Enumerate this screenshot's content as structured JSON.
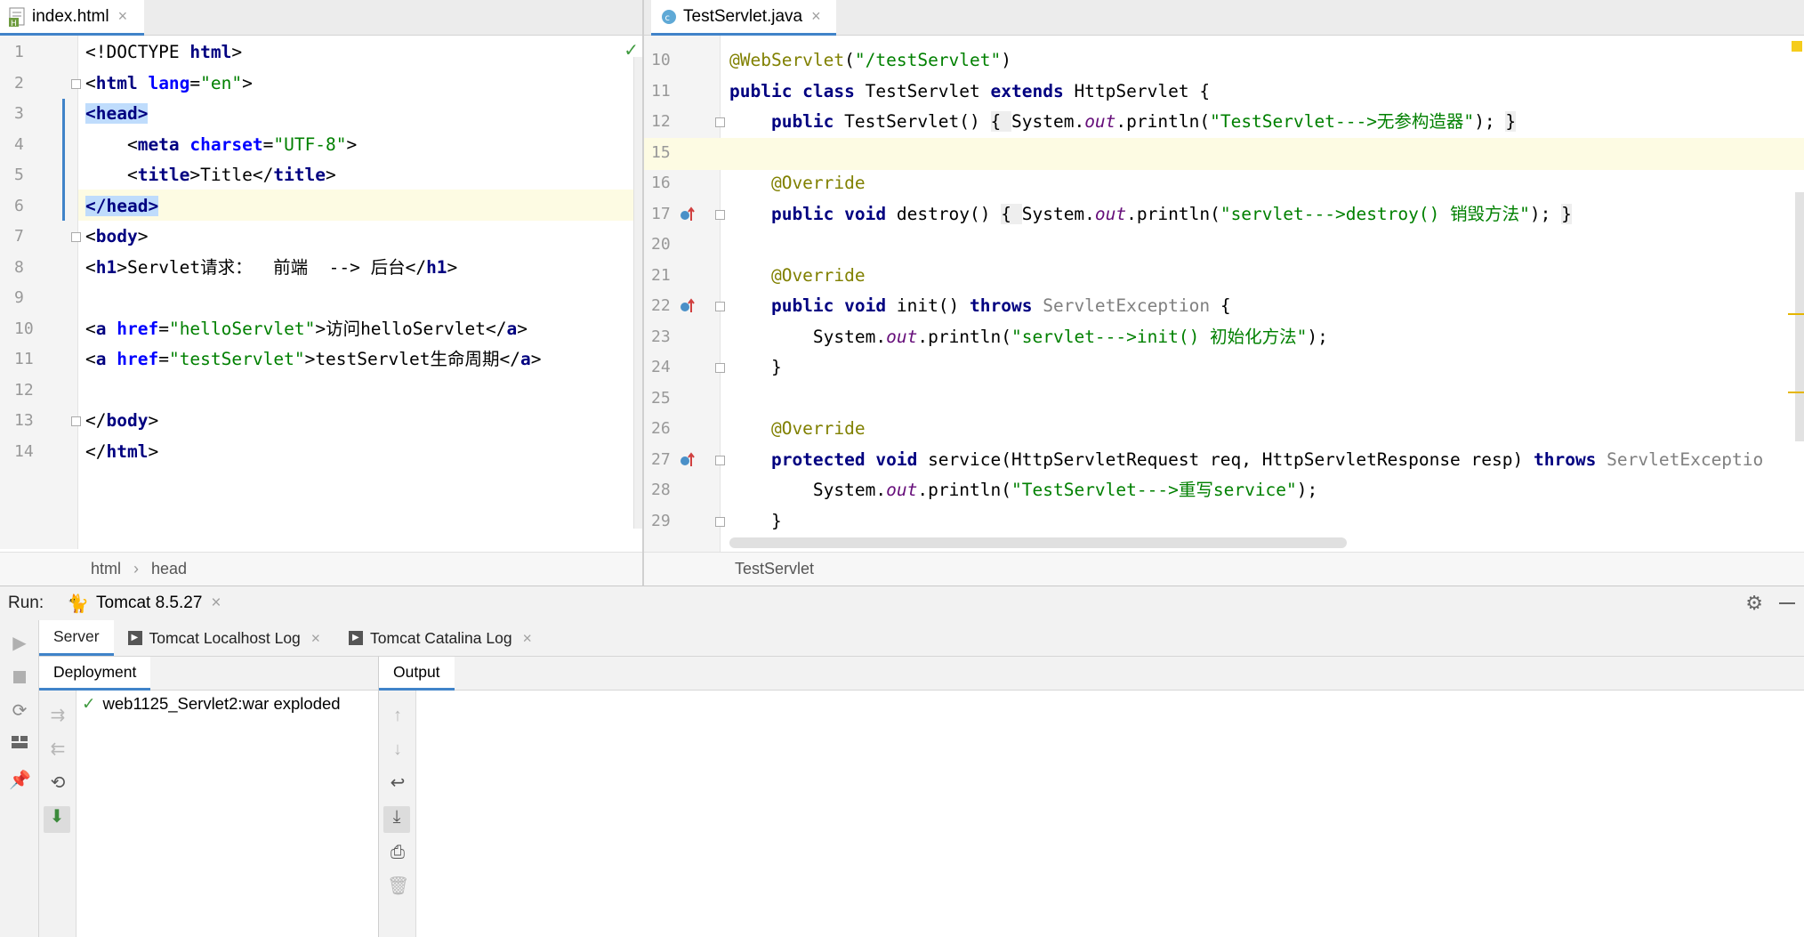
{
  "left_editor": {
    "tab": {
      "label": "index.html",
      "close": "×"
    },
    "lines": [
      {
        "n": "1"
      },
      {
        "n": "2"
      },
      {
        "n": "3"
      },
      {
        "n": "4"
      },
      {
        "n": "5"
      },
      {
        "n": "6"
      },
      {
        "n": "7"
      },
      {
        "n": "8"
      },
      {
        "n": "9"
      },
      {
        "n": "10"
      },
      {
        "n": "11"
      },
      {
        "n": "12"
      },
      {
        "n": "13"
      },
      {
        "n": "14"
      }
    ],
    "code": {
      "l1a": "<!DOCTYPE ",
      "l1b": "html",
      "l1c": ">",
      "l2a": "<",
      "l2b": "html ",
      "l2c": "lang",
      "l2d": "=",
      "l2e": "\"en\"",
      "l2f": ">",
      "l3": "<head>",
      "l4a": "    <",
      "l4b": "meta ",
      "l4c": "charset",
      "l4d": "=",
      "l4e": "\"UTF-8\"",
      "l4f": ">",
      "l5a": "    <",
      "l5b": "title",
      "l5c": ">Title</",
      "l5d": "title",
      "l5e": ">",
      "l6": "</head>",
      "l7a": "<",
      "l7b": "body",
      "l7c": ">",
      "l8a": "<",
      "l8b": "h1",
      "l8c": ">Servlet请求：  前端  --> 后台</",
      "l8d": "h1",
      "l8e": ">",
      "l10a": "<",
      "l10b": "a ",
      "l10c": "href",
      "l10d": "=",
      "l10e": "\"helloServlet\"",
      "l10f": ">访问helloServlet</",
      "l10g": "a",
      "l10h": ">",
      "l11a": "<",
      "l11b": "a ",
      "l11c": "href",
      "l11d": "=",
      "l11e": "\"testServlet\"",
      "l11f": ">testServlet生命周期</",
      "l11g": "a",
      "l11h": ">",
      "l13a": "</",
      "l13b": "body",
      "l13c": ">",
      "l14a": "</",
      "l14b": "html",
      "l14c": ">"
    },
    "breadcrumb": [
      "html",
      "head"
    ],
    "breadcrumb_sep": "›"
  },
  "right_editor": {
    "tab": {
      "label": "TestServlet.java",
      "close": "×"
    },
    "lines": [
      "10",
      "11",
      "12",
      "15",
      "16",
      "17",
      "20",
      "21",
      "22",
      "23",
      "24",
      "25",
      "26",
      "27",
      "28",
      "29"
    ],
    "code": {
      "r10a": "@WebServlet",
      "r10b": "(",
      "r10c": "\"/testServlet\"",
      "r10d": ")",
      "r11a": "public class ",
      "r11b": "TestServlet ",
      "r11c": "extends ",
      "r11d": "HttpServlet {",
      "r12a": "    public ",
      "r12b": "TestServlet() ",
      "r12c": "{ ",
      "r12d": "System.",
      "r12e": "out",
      "r12f": ".println(",
      "r12g": "\"TestServlet--->无参构造器\"",
      "r12h": "); ",
      "r12i": "}",
      "r16": "    @Override",
      "r17a": "    public void ",
      "r17b": "destroy() ",
      "r17c": "{ ",
      "r17d": "System.",
      "r17e": "out",
      "r17f": ".println(",
      "r17g": "\"servlet--->destroy() 销毁方法\"",
      "r17h": "); ",
      "r17i": "}",
      "r21": "    @Override",
      "r22a": "    public void ",
      "r22b": "init() ",
      "r22c": "throws ",
      "r22d": "ServletException ",
      "r22e": "{",
      "r23a": "        System.",
      "r23b": "out",
      "r23c": ".println(",
      "r23d": "\"servlet--->init() 初始化方法\"",
      "r23e": ");",
      "r24": "    }",
      "r26": "    @Override",
      "r27a": "    protected void ",
      "r27b": "service(HttpServletRequest req, HttpServletResponse resp) ",
      "r27c": "throws ",
      "r27d": "ServletExceptio",
      "r28a": "        System.",
      "r28b": "out",
      "r28c": ".println(",
      "r28d": "\"TestServlet--->重写service\"",
      "r28e": ");",
      "r29": "    }"
    },
    "breadcrumb": "TestServlet"
  },
  "run_panel": {
    "run_label": "Run:",
    "config_tab": "Tomcat 8.5.27",
    "config_close": "×",
    "subtabs": [
      {
        "label": "Server"
      },
      {
        "label": "Tomcat Localhost Log",
        "close": "×"
      },
      {
        "label": "Tomcat Catalina Log",
        "close": "×"
      }
    ],
    "deployment": {
      "header": "Deployment",
      "item": "web1125_Servlet2:war exploded"
    },
    "output": {
      "header": "Output"
    }
  },
  "colors": {
    "accent": "#4083c9",
    "selection": "#bfdcfc",
    "caret_line": "#fdfbe3"
  }
}
